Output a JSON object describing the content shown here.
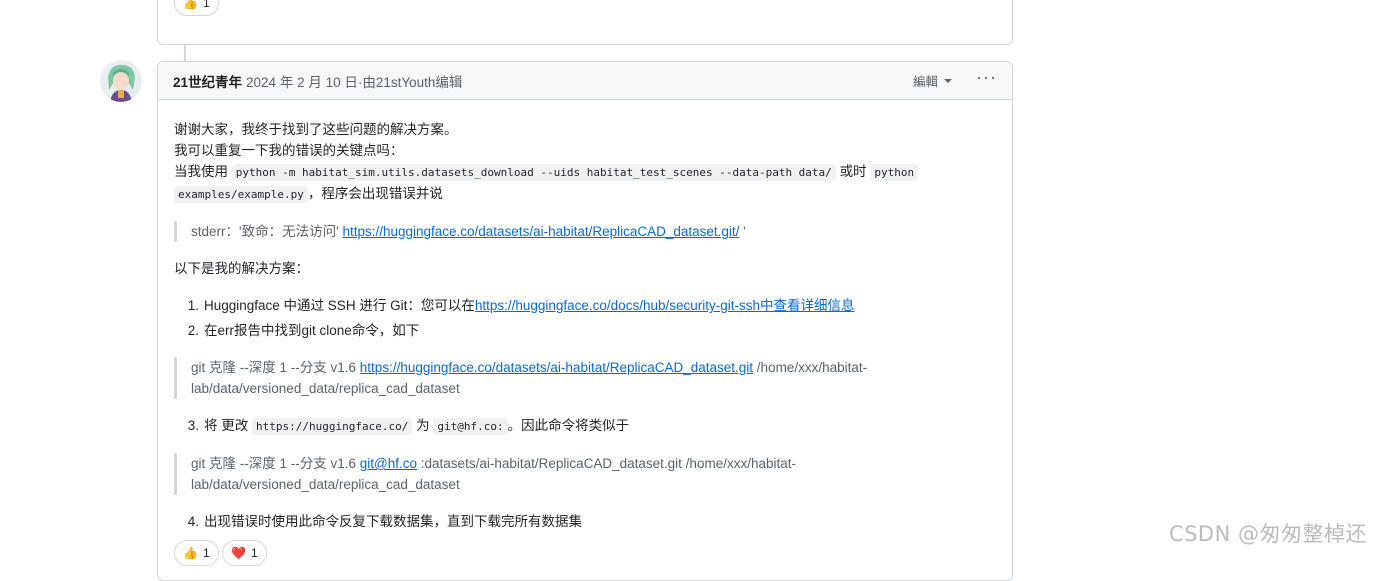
{
  "previous_comment": {
    "reaction": {
      "emoji": "👍",
      "count": "1"
    }
  },
  "comment": {
    "author": "21世纪青年",
    "meta": "2024 年 2 月 10 日·由21stYouth编辑",
    "edit_label": "編輯",
    "more_label": "···",
    "intro_line1": "谢谢大家，我终于找到了这些问题的解决方案。",
    "intro_line2": "我可以重复一下我的错误的关键点吗：",
    "when_prefix": "当我使用",
    "cmd1": "python -m habitat_sim.utils.datasets_download --uids habitat_test_scenes --data-path data/",
    "or_text": "或时",
    "cmd2a": "python",
    "cmd2b": "examples/example.py",
    "error_suffix": "，程序会出现错误并说",
    "stderr_prefix": "stderr：'致命：无法访问'",
    "stderr_link": "https://huggingface.co/datasets/ai-habitat/ReplicaCAD_dataset.git/",
    "stderr_suffix": "'",
    "solution_heading": "以下是我的解决方案：",
    "step1_num": "1.",
    "step1_text": "Huggingface 中通过 SSH 进行 Git：您可以在",
    "step1_link": "https://huggingface.co/docs/hub/security-git-ssh中查看详细信息",
    "step2_num": "2.",
    "step2_text": "在err报告中找到git clone命令，如下",
    "quote2_prefix": "git 克隆 --深度 1 --分支 v1.6",
    "quote2_link": "https://huggingface.co/datasets/ai-habitat/ReplicaCAD_dataset.git",
    "quote2_suffix1": " /home/xxx/habitat-",
    "quote2_suffix2": "lab/data/versioned_data/replica_cad_dataset",
    "step3_num": "3.",
    "step3_a": "将 更改",
    "step3_code1": "https://huggingface.co/",
    "step3_b": "为",
    "step3_code2": "git@hf.co:",
    "step3_c": "。因此命令将类似于",
    "quote3_prefix": "git 克隆 --深度 1 --分支 v1.6",
    "quote3_link": "git@hf.co",
    "quote3_suffix1": " :datasets/ai-habitat/ReplicaCAD_dataset.git /home/xxx/habitat-",
    "quote3_suffix2": "lab/data/versioned_data/replica_cad_dataset",
    "step4_num": "4.",
    "step4_text": "出现错误时使用此命令反复下载数据集，直到下载完所有数据集",
    "reactions": [
      {
        "emoji": "👍",
        "count": "1"
      },
      {
        "emoji": "❤️",
        "count": "1"
      }
    ]
  },
  "watermark": "CSDN @匆匆整棹还",
  "colors": {
    "link": "#0969da",
    "border": "#d0d7de",
    "header_bg": "#f6f8fa",
    "muted": "#59636e"
  }
}
